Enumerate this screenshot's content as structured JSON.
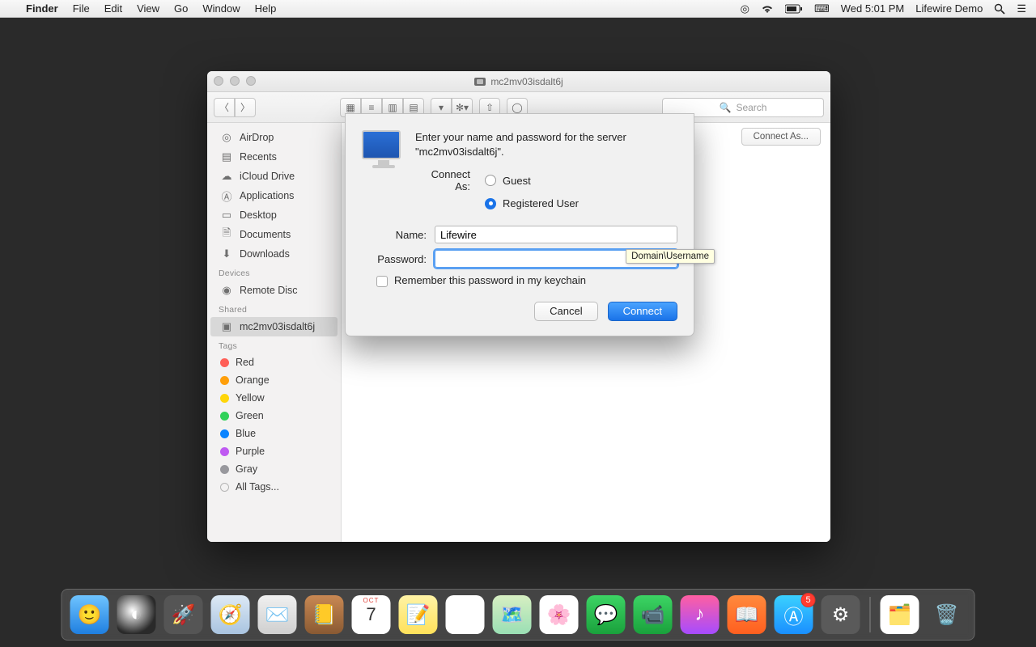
{
  "menubar": {
    "app": "Finder",
    "items": [
      "File",
      "Edit",
      "View",
      "Go",
      "Window",
      "Help"
    ],
    "clock": "Wed 5:01 PM",
    "user": "Lifewire Demo"
  },
  "finder": {
    "title": "mc2mv03isdalt6j",
    "search_placeholder": "Search",
    "connect_as_btn": "Connect As...",
    "sidebar": {
      "favorites": [
        "AirDrop",
        "Recents",
        "iCloud Drive",
        "Applications",
        "Desktop",
        "Documents",
        "Downloads"
      ],
      "devices_head": "Devices",
      "devices": [
        "Remote Disc"
      ],
      "shared_head": "Shared",
      "shared": [
        "mc2mv03isdalt6j"
      ],
      "tags_head": "Tags",
      "tags": [
        "Red",
        "Orange",
        "Yellow",
        "Green",
        "Blue",
        "Purple",
        "Gray",
        "All Tags..."
      ]
    }
  },
  "dialog": {
    "prompt": "Enter your name and password for the server \"mc2mv03isdalt6j\".",
    "connect_as_label": "Connect As:",
    "guest": "Guest",
    "registered": "Registered User",
    "name_label": "Name:",
    "name_value": "Lifewire",
    "password_label": "Password:",
    "tooltip": "Domain\\Username",
    "remember": "Remember this password in my keychain",
    "cancel": "Cancel",
    "connect": "Connect"
  },
  "dock": {
    "cal_month": "OCT",
    "cal_day": "7",
    "badge": "5"
  }
}
